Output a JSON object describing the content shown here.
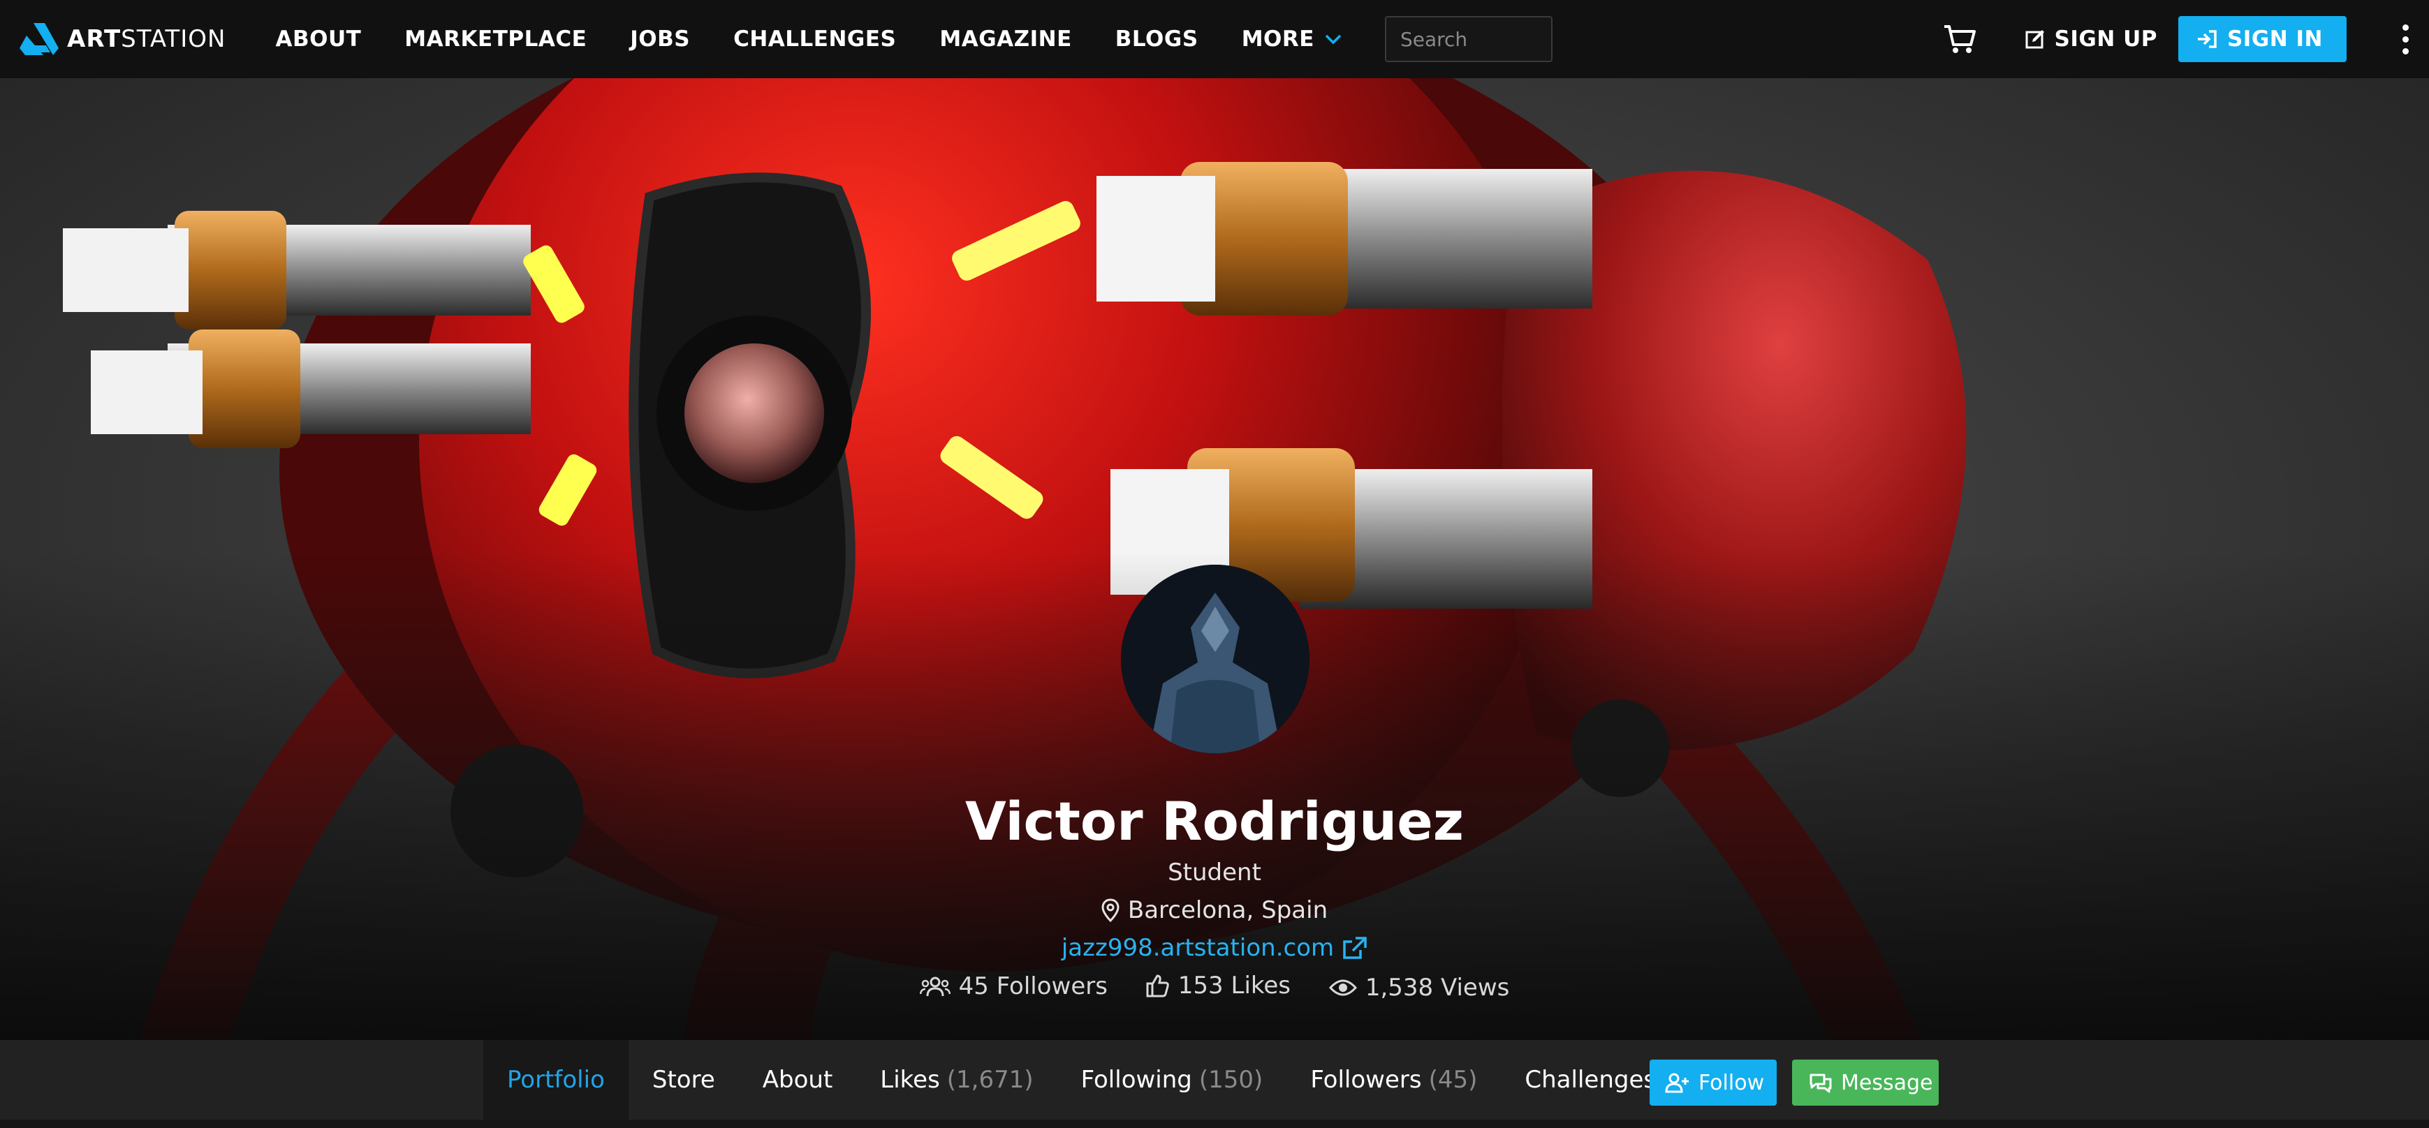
{
  "header": {
    "logo_bold": "ART",
    "logo_light": "STATION",
    "nav": [
      "ABOUT",
      "MARKETPLACE",
      "JOBS",
      "CHALLENGES",
      "MAGAZINE",
      "BLOGS",
      "MORE"
    ],
    "search_placeholder": "Search",
    "sign_up": "SIGN UP",
    "sign_in": "SIGN IN"
  },
  "profile": {
    "name": "Victor Rodriguez",
    "headline": "Student",
    "location": "Barcelona, Spain",
    "website": "jazz998.artstation.com",
    "stats": {
      "followers": "45 Followers",
      "likes": "153 Likes",
      "views": "1,538 Views"
    }
  },
  "tabs": {
    "portfolio": "Portfolio",
    "store": "Store",
    "about": "About",
    "likes_label": "Likes",
    "likes_count": "(1,671)",
    "following_label": "Following",
    "following_count": "(150)",
    "followers_label": "Followers",
    "followers_count": "(45)",
    "challenges": "Challenges"
  },
  "actions": {
    "follow": "Follow",
    "message": "Message"
  },
  "colors": {
    "accent": "#13aff0",
    "message_green": "#49b65a",
    "topbar": "#111111"
  },
  "icons": [
    "cart-icon",
    "edit-icon",
    "sign-in-icon",
    "kebab-icon",
    "map-pin-icon",
    "external-link-icon",
    "users-icon",
    "thumbs-up-icon",
    "eye-icon",
    "user-plus-icon",
    "chat-icon"
  ]
}
